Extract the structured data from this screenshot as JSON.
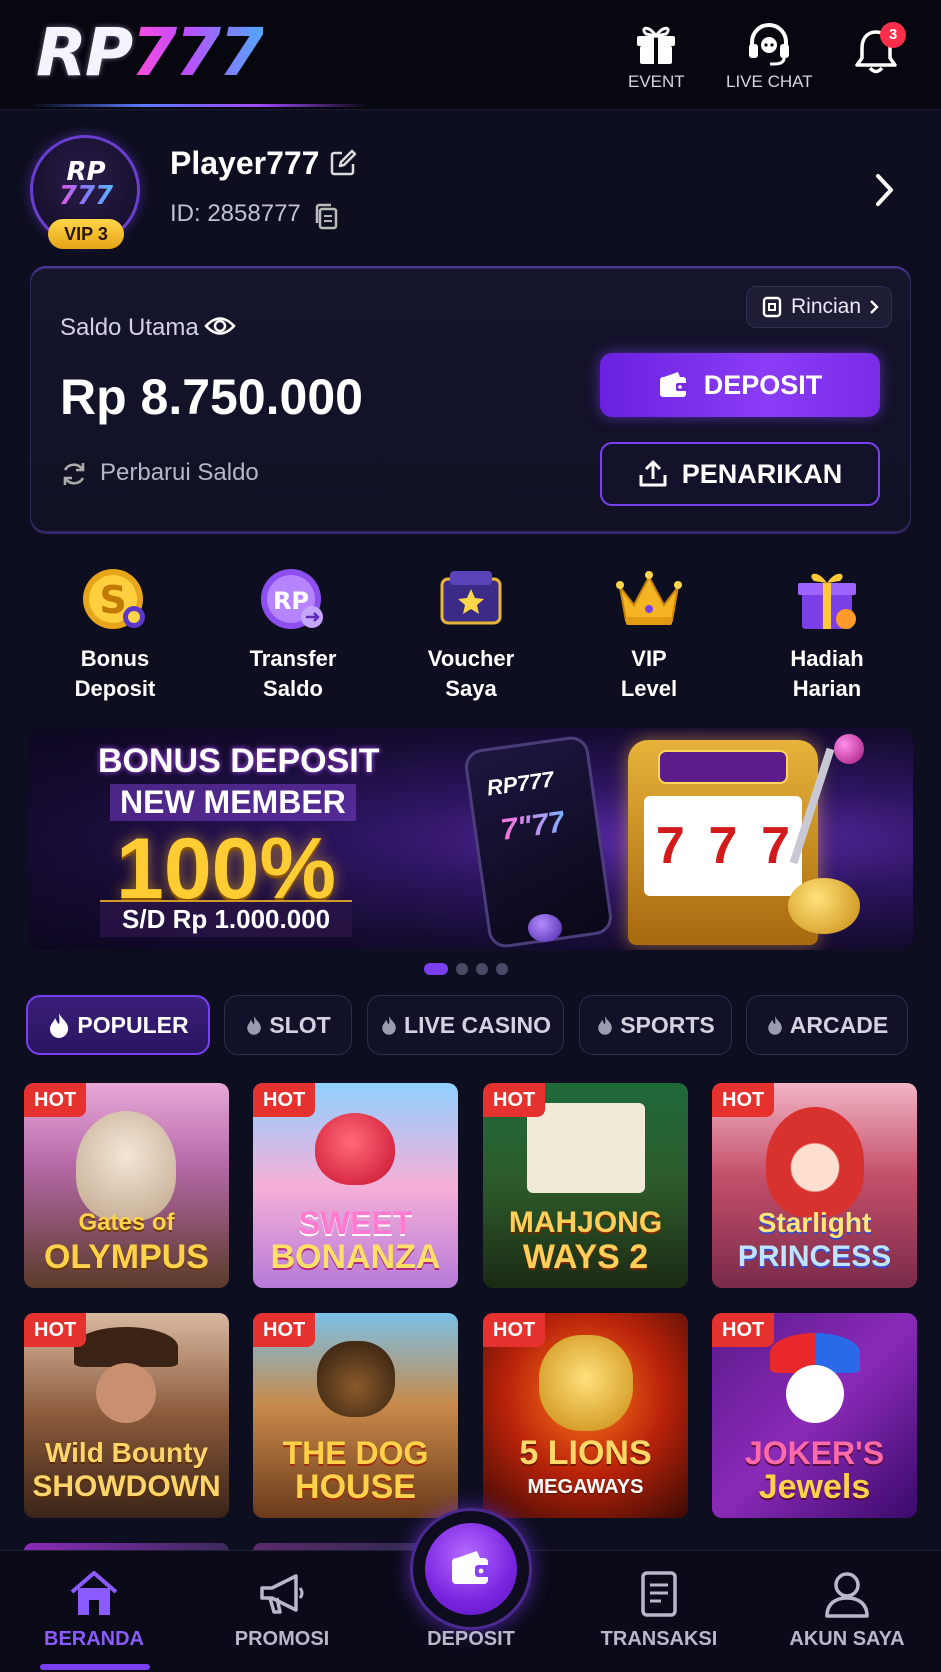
{
  "header": {
    "logo_text_a": "RP",
    "logo_text_b": "777",
    "event_label": "EVENT",
    "live_chat_label": "LIVE CHAT",
    "notification_count": "3"
  },
  "profile": {
    "avatar_text_a": "RP",
    "avatar_text_b": "777",
    "vip_badge": "VIP 3",
    "username": "Player777",
    "id_text": "ID: 2858777"
  },
  "balance": {
    "label": "Saldo Utama",
    "amount": "Rp 8.750.000",
    "refresh_label": "Perbarui Saldo",
    "detail_label": "Rincian",
    "deposit_label": "DEPOSIT",
    "withdraw_label": "PENARIKAN"
  },
  "quick_actions": [
    {
      "line1": "Bonus",
      "line2": "Deposit",
      "icon": "coin-icon"
    },
    {
      "line1": "Transfer",
      "line2": "Saldo",
      "icon": "rp-coin-icon"
    },
    {
      "line1": "Voucher",
      "line2": "Saya",
      "icon": "voucher-icon"
    },
    {
      "line1": "VIP",
      "line2": "Level",
      "icon": "crown-icon"
    },
    {
      "line1": "Hadiah",
      "line2": "Harian",
      "icon": "gift-icon"
    }
  ],
  "banner": {
    "line1": "BONUS DEPOSIT",
    "line2": "NEW MEMBER",
    "percent": "100%",
    "line3": "S/D Rp 1.000.000",
    "phone_text_a": "RP777",
    "phone_text_b": "7\"77",
    "reels": [
      "7",
      "7",
      "7"
    ],
    "slide_count": 4,
    "active_slide": 1
  },
  "tabs": [
    {
      "label": "POPULER",
      "active": true
    },
    {
      "label": "SLOT",
      "active": false
    },
    {
      "label": "LIVE CASINO",
      "active": false
    },
    {
      "label": "SPORTS",
      "active": false
    },
    {
      "label": "ARCADE",
      "active": false
    }
  ],
  "games": [
    {
      "badge": "HOT",
      "title1": "Gates of",
      "title2": "OLYMPUS"
    },
    {
      "badge": "HOT",
      "title1": "SWEET",
      "title2": "BONANZA"
    },
    {
      "badge": "HOT",
      "title1": "MAHJONG",
      "title2": "WAYS 2"
    },
    {
      "badge": "HOT",
      "title1": "Starlight",
      "title2": "PRINCESS"
    },
    {
      "badge": "HOT",
      "title1": "Wild Bounty",
      "title2": "SHOWDOWN"
    },
    {
      "badge": "HOT",
      "title1": "THE DOG",
      "title2": "HOUSE"
    },
    {
      "badge": "HOT",
      "title1": "5 LIONS",
      "title2": "MEGAWAYS"
    },
    {
      "badge": "HOT",
      "title1": "JOKER'S",
      "title2": "Jewels"
    }
  ],
  "bottom_nav": [
    {
      "label": "BERANDA",
      "active": true
    },
    {
      "label": "PROMOSI",
      "active": false
    },
    {
      "label": "DEPOSIT",
      "active": false
    },
    {
      "label": "TRANSAKSI",
      "active": false
    },
    {
      "label": "AKUN SAYA",
      "active": false
    }
  ],
  "colors": {
    "background": "#0d0e1f",
    "accent": "#7b3ff2",
    "hot_badge": "#e5322e",
    "vip_gold": "#ffd54a"
  }
}
